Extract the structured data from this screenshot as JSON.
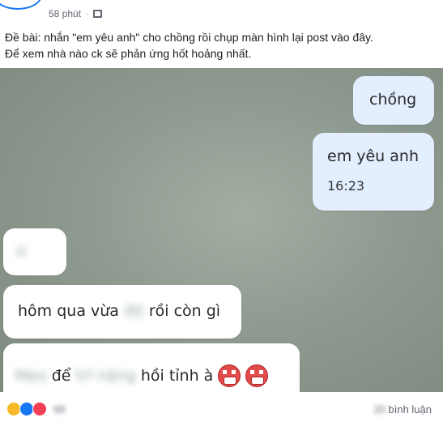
{
  "header": {
    "author": "",
    "time": "58 phút",
    "separator": "·",
    "audience_icon": "friends-icon"
  },
  "post": {
    "line1": "Đề bài: nhắn \"em yêu anh\" cho chồng rồi chụp màn hình lại post vào đây.",
    "line2": "Để xem nhà nào ck sẽ phản ứng hốt hoảng nhất."
  },
  "chat": {
    "sent": [
      {
        "text": "chồng"
      },
      {
        "text": "em yêu anh",
        "time": "16:23"
      }
    ],
    "received": [
      {
        "text": "ừ"
      },
      {
        "text_before": "hôm qua vừa",
        "text_blurred": "địt",
        "text_after": "rồi còn gì"
      },
      {
        "text_blurred_a": "Mẹo",
        "text_mid": "để",
        "text_blurred_b": "trĩ nặng",
        "text_after": "hồi tỉnh à"
      }
    ]
  },
  "footer": {
    "reactions": [
      "haha-icon",
      "like-icon",
      "love-icon"
    ],
    "reaction_count": "99",
    "comment_count": "20",
    "comment_label": "bình luận"
  },
  "colors": {
    "sent_bubble": "#e3eefe",
    "received_bubble": "#ffffff",
    "brand": "#1877f2",
    "meta_text": "#606770"
  }
}
